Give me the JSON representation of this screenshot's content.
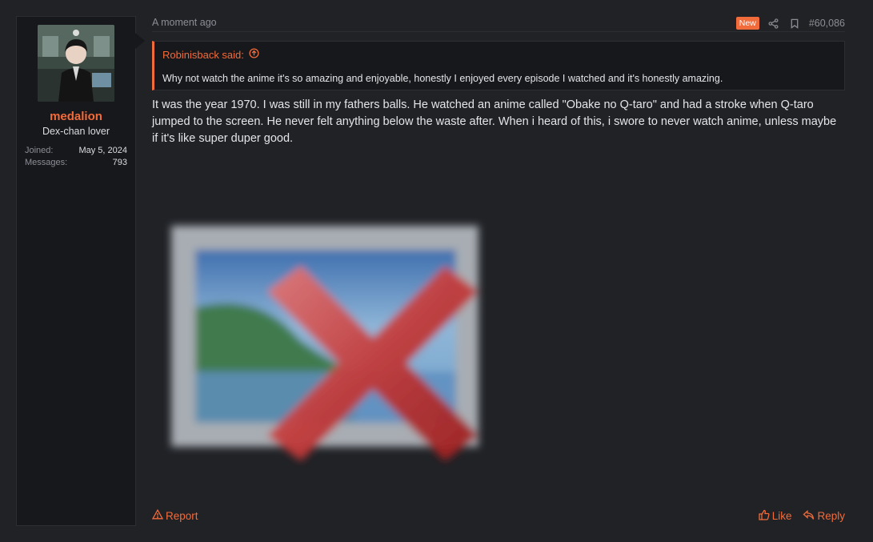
{
  "user": {
    "name": "medalion",
    "title": "Dex-chan lover",
    "stats": [
      {
        "label": "Joined:",
        "value": "May 5, 2024"
      },
      {
        "label": "Messages:",
        "value": "793"
      }
    ]
  },
  "post": {
    "date": "A moment ago",
    "badge": "New",
    "number": "#60,086",
    "quote": {
      "author": "Robinisback said:",
      "text": "Why not watch the anime it's so amazing and enjoyable, honestly I enjoyed every episode I watched and it's honestly amazing."
    },
    "message": "It was the year 1970. I was still in my fathers balls. He watched an anime called \"Obake no Q-taro\" and had a stroke when Q-taro jumped to the screen. He never felt anything below the waste after. When i heard of this, i swore to never watch anime, unless maybe if it's like super duper good.",
    "actions": {
      "report": "Report",
      "like": "Like",
      "reply": "Reply"
    }
  },
  "colors": {
    "accent": "#f26b3a",
    "background": "#202226",
    "panel": "#17181b",
    "text": "#e4e5e8",
    "muted": "#8b8e95"
  },
  "icons": {
    "share": "share-icon",
    "bookmark": "bookmark-icon",
    "quote_jump": "arrow-up-circle-icon",
    "report": "warning-triangle-icon",
    "like": "thumbs-up-icon",
    "reply": "reply-arrow-icon",
    "broken_image": "broken-image-icon"
  }
}
